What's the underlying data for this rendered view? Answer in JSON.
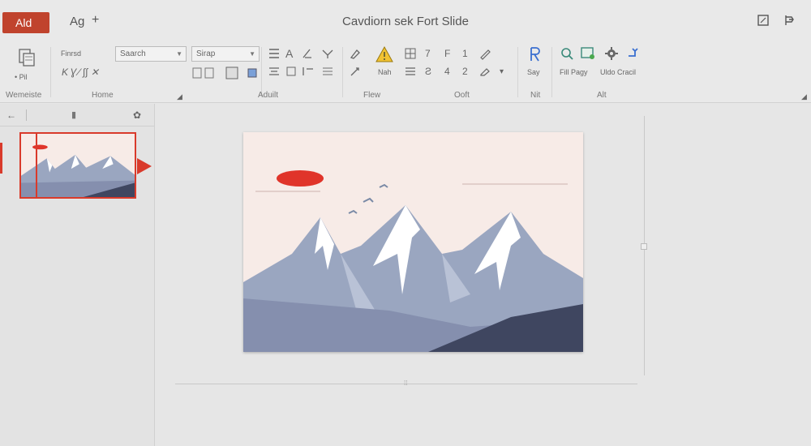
{
  "titlebar": {
    "app_button": "Ald",
    "quick_access_text": "Ag",
    "quick_access_plus": "+",
    "title": "Cavdiorn sek Fort Slide"
  },
  "ribbon": {
    "groups": {
      "g1": "Wemeiste",
      "g2": "Home",
      "g3": "Aduilt",
      "g4": "Flew",
      "g5": "Ooft",
      "g6": "Nit",
      "g7": "Alt"
    },
    "paste_caption": "• Pil",
    "font_label": "Finrsd",
    "search_dropdown": "Saarch",
    "size_dropdown": "Sirap",
    "warn_caption": "Nah",
    "say_caption": "Say",
    "fill_caption": "Fill Pagy",
    "undo_caption": "Uldo Cracil",
    "row2_icons": "K  Ɣ  ⁄  ∫∫  ✕",
    "digits": {
      "d1": "7",
      "d2": "1",
      "d3": "4",
      "d4": "2",
      "d5": "F",
      "d6": "Ƨ"
    }
  },
  "colors": {
    "accent": "#d93a2b",
    "app_button_bg": "#c0432d",
    "sun": "#e0342a",
    "sky": "#f7ebe7",
    "mountain": "#9aa6c0",
    "snow": "#ffffff",
    "foreground_dark": "#3f4660"
  },
  "icons": {
    "back": "←",
    "menu": "▮",
    "expand": "✿",
    "page": "▢",
    "window": "⇴"
  }
}
